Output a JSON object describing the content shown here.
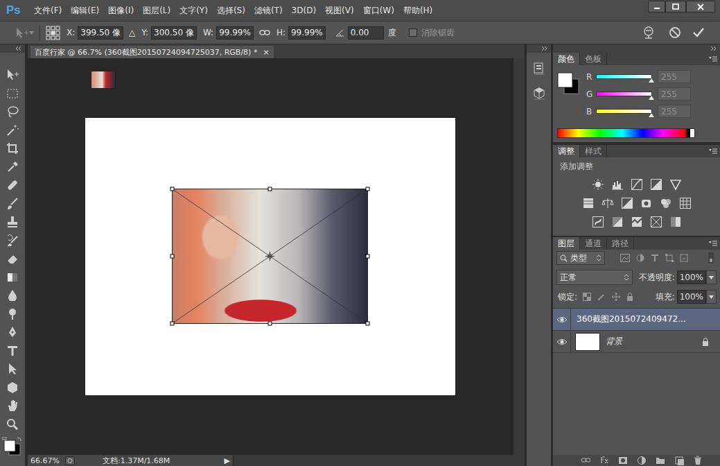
{
  "app": {
    "logo": "Ps"
  },
  "menu": [
    "文件(F)",
    "编辑(E)",
    "图像(I)",
    "图层(L)",
    "文字(Y)",
    "选择(S)",
    "滤镜(T)",
    "3D(D)",
    "视图(V)",
    "窗口(W)",
    "帮助(H)"
  ],
  "options": {
    "fields": [
      {
        "label": "X:",
        "value": "399.50 像"
      },
      {
        "label": "Y:",
        "value": "300.50 像"
      },
      {
        "label": "W:",
        "value": "99.99%"
      },
      {
        "label": "H:",
        "value": "99.99%"
      }
    ],
    "relative_mark": "△",
    "angle": {
      "value": "0.00",
      "unit": "度"
    },
    "antialias": {
      "label": "消除锯齿",
      "checked": false
    }
  },
  "document": {
    "tab": "百度行家 @ 66.7% (360截图20150724094725037, RGB/8) *",
    "close": "×"
  },
  "status_bar": {
    "zoom": "66.67%",
    "doc": "文档:1.37M/1.68M",
    "arrow": "▶"
  },
  "color_panel": {
    "tabs": [
      {
        "label": "颜色",
        "selected": true
      },
      {
        "label": "色板",
        "selected": false
      }
    ],
    "channels": [
      {
        "name": "R",
        "value": "255",
        "level": 1,
        "color": "#00ffff"
      },
      {
        "name": "G",
        "value": "255",
        "level": 1,
        "color": "#ff00ff"
      },
      {
        "name": "B",
        "value": "255",
        "level": 1,
        "color": "#ffff00"
      }
    ]
  },
  "adjustments_panel": {
    "tabs": [
      {
        "label": "调整",
        "selected": true
      },
      {
        "label": "样式",
        "selected": false
      }
    ],
    "heading": "添加调整"
  },
  "layers_panel": {
    "tabs": [
      {
        "label": "图层",
        "selected": true
      },
      {
        "label": "通道",
        "selected": false
      },
      {
        "label": "路径",
        "selected": false
      }
    ],
    "filter": "类型",
    "blend_mode": "正常",
    "opacity_label": "不透明度:",
    "opacity": "100%",
    "lock_label": "锁定:",
    "fill_label": "填充:",
    "fill": "100%",
    "layers": [
      {
        "name": "360截图2015072409472...",
        "selected": true,
        "visible": true,
        "locked": false,
        "kind": "photo"
      },
      {
        "name": "背景",
        "selected": false,
        "visible": true,
        "locked": true,
        "kind": "fill"
      }
    ]
  }
}
